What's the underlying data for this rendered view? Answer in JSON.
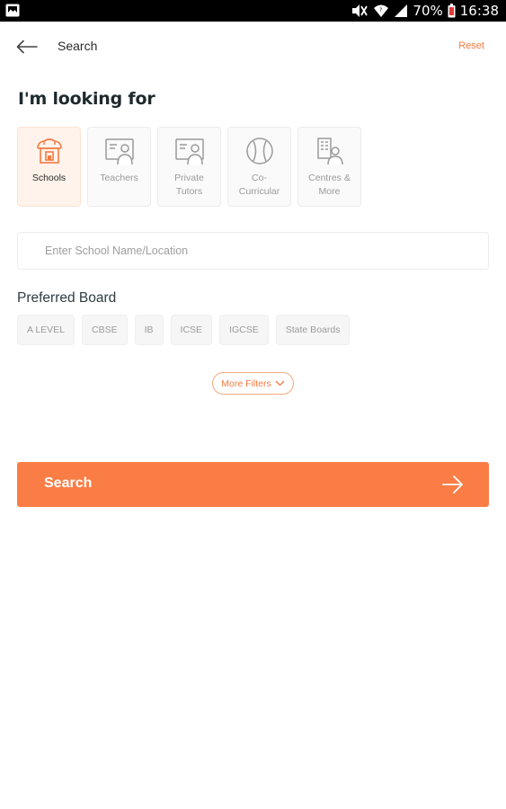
{
  "status_bar": {
    "battery": "70%",
    "time": "16:38"
  },
  "header": {
    "title": "Search",
    "reset_label": "Reset"
  },
  "heading": "I'm looking for",
  "categories": [
    {
      "label": "Schools",
      "icon": "school-icon",
      "selected": true
    },
    {
      "label": "Teachers",
      "icon": "teacher-icon",
      "selected": false
    },
    {
      "label": "Private\nTutors",
      "icon": "tutor-icon",
      "selected": false
    },
    {
      "label": "Co-\nCurricular",
      "icon": "ball-icon",
      "selected": false
    },
    {
      "label": "Centres &\nMore",
      "icon": "centre-icon",
      "selected": false
    }
  ],
  "search": {
    "placeholder": "Enter School Name/Location",
    "value": ""
  },
  "board": {
    "title": "Preferred Board",
    "options": [
      "A LEVEL",
      "CBSE",
      "IB",
      "ICSE",
      "IGCSE",
      "State Boards"
    ]
  },
  "more_filters_label": "More Filters",
  "search_button_label": "Search",
  "colors": {
    "accent": "#fa7d45",
    "accent_text": "#f47b42",
    "selected_tile_bg": "#fff3ec"
  }
}
